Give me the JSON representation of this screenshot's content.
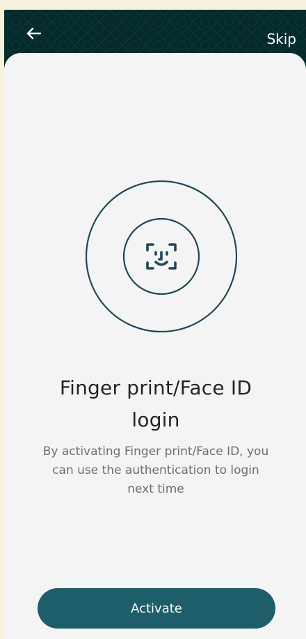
{
  "header": {
    "back_icon": "arrow-left-icon",
    "skip_label": "Skip",
    "background_color": "#062a2b"
  },
  "graphic": {
    "icon": "face-id-icon",
    "stroke_color": "#1e4756"
  },
  "content": {
    "title_lines": [
      "Finger print/Face ID",
      "login"
    ],
    "description_lines": [
      "By activating Finger print/Face ID, you",
      "can use the authentication to login",
      "next time"
    ]
  },
  "actions": {
    "activate_label": "Activate",
    "accent_color": "#1e5d6a"
  }
}
